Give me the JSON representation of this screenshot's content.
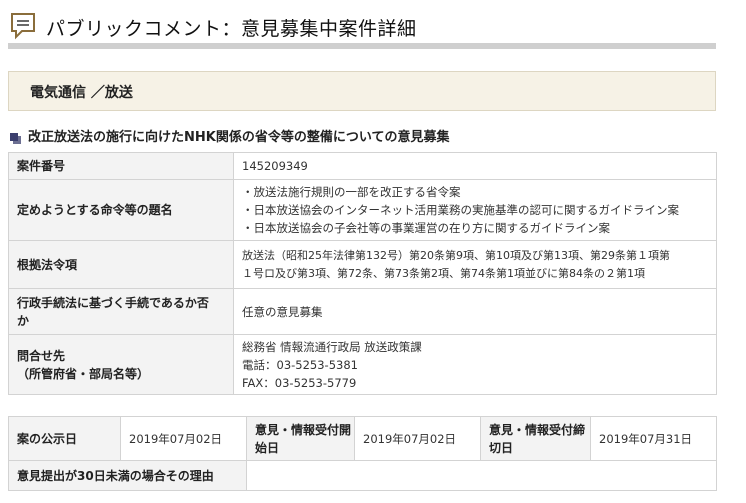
{
  "page": {
    "title": "パブリックコメント：意見募集中案件詳細"
  },
  "category": "電気通信 ／放送",
  "subject": "改正放送法の施行に向けたNHK関係の省令等の整備についての意見募集",
  "details": {
    "case_number_label": "案件番号",
    "case_number": "145209349",
    "title_label": "定めようとする命令等の題名",
    "title_lines": [
      "・放送法施行規則の一部を改正する省令案",
      "・日本放送協会のインターネット活用業務の実施基準の認可に関するガイドライン案",
      "・日本放送協会の子会社等の事業運営の在り方に関するガイドライン案"
    ],
    "basis_label": "根拠法令項",
    "basis_lines": [
      "放送法（昭和25年法律第132号）第20条第9項、第10項及び第13項、第29条第１項第",
      "１号ロ及び第3項、第72条、第73条第2項、第74条第1項並びに第84条の２第1項"
    ],
    "procedure_label_lines": [
      "行政手続法に基づく手続であるか否",
      "か"
    ],
    "procedure_value": "任意の意見募集",
    "contact_label_lines": [
      "問合せ先",
      "（所管府省・部局名等）"
    ],
    "contact_lines": [
      "総務省 情報流通行政局 放送政策課",
      "電話：03-5253-5381",
      "FAX：03-5253-5779"
    ]
  },
  "dates": {
    "published_label": "案の公示日",
    "published_value": "2019年07月02日",
    "start_label_lines": [
      "意見・情報受付開",
      "始日"
    ],
    "start_value": "2019年07月02日",
    "end_label_lines": [
      "意見・情報受付締",
      "切日"
    ],
    "end_value": "2019年07月31日",
    "reason_label": "意見提出が30日未満の場合その理由",
    "reason_value": ""
  },
  "colors": {
    "header_rule": "#cfcfcf",
    "category_bg": "#f6f2e6",
    "label_bg": "#f3f3f3",
    "bullet": "#3b3f6e"
  },
  "icons": {
    "header": "comment-bubble-icon",
    "subject": "square-bullet-icon"
  }
}
